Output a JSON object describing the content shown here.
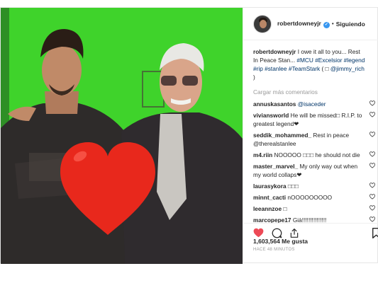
{
  "header": {
    "username": "robertdowneyjr",
    "verified_icon": "verified-badge-icon",
    "separator": "•",
    "follow_status": "Siguiendo"
  },
  "caption": {
    "username": "robertdowneyjr",
    "text": "I owe it all to you... Rest In Peace Stan...",
    "tags": [
      "#MCU",
      "#Excelsior",
      "#legend",
      "#rip",
      "#stanlee",
      "#TeamStark"
    ],
    "tail_open": "( ",
    "emoji": "□",
    "mention": "@jimmy_rich",
    "tail_close": " )"
  },
  "load_more": "Cargar más comentarios",
  "comments": [
    {
      "user": "annuskasantos",
      "text": "@isaceder",
      "mention": true
    },
    {
      "user": "viviansworld",
      "text": "He will be missed□ R.I.P. to greatest legend❤"
    },
    {
      "user": "seddik_mohammed_",
      "text": "Rest in peace @therealstanlee"
    },
    {
      "user": "m4.riin",
      "text": "NOOOOO □□□ he should not die"
    },
    {
      "user": "master_marvel_",
      "text": "My only way out when my world collaps❤"
    },
    {
      "user": "laurasykora",
      "text": "□□□"
    },
    {
      "user": "minnt_cacti",
      "text": "nOOOOOOOOO"
    },
    {
      "user": "leeannzoe",
      "text": "□"
    },
    {
      "user": "marcopepe17",
      "text": "Già!!!!!!!!!!!!!!!"
    }
  ],
  "actions": {
    "like_icon": "heart-filled-icon",
    "comment_icon": "comment-icon",
    "share_icon": "share-icon",
    "save_icon": "bookmark-icon",
    "like_color": "#ed4956"
  },
  "likes": "1,603,564 Me gusta",
  "timestamp": "HACE 48 MINUTOS",
  "photo": {
    "background_color": "#3fd32b",
    "overlay_icon": "big-red-heart-icon",
    "overlay_color": "#e8281c"
  }
}
